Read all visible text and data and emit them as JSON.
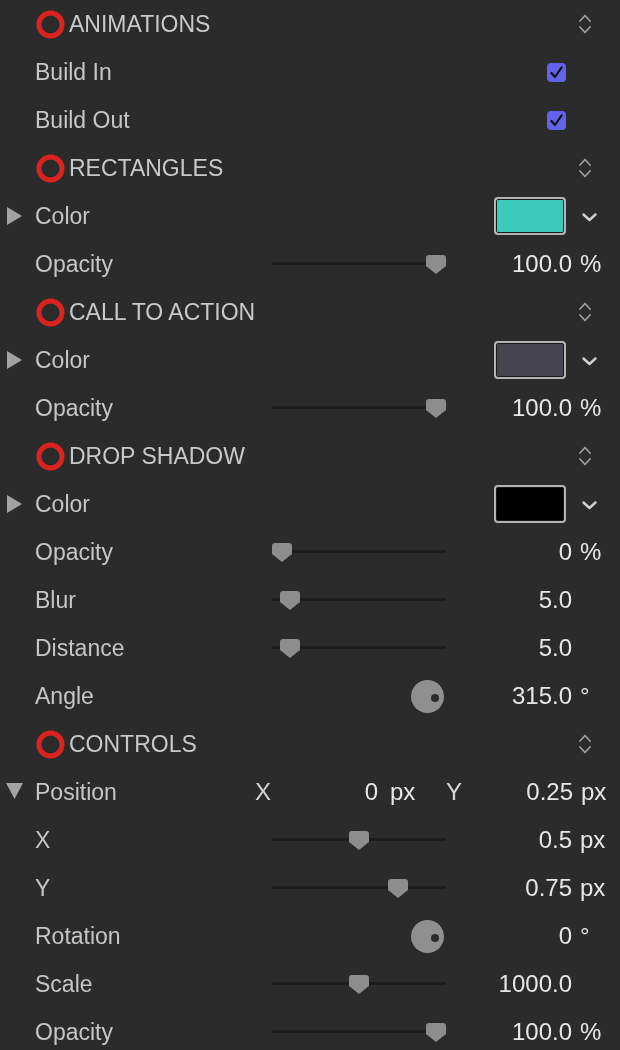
{
  "sections": [
    {
      "title": "ANIMATIONS",
      "params": [
        {
          "kind": "checkbox",
          "label": "Build In",
          "checked": true
        },
        {
          "kind": "checkbox",
          "label": "Build Out",
          "checked": true
        }
      ]
    },
    {
      "title": "RECTANGLES",
      "params": [
        {
          "kind": "color",
          "label": "Color",
          "expanded": false,
          "color": "#3ccbbb"
        },
        {
          "kind": "slider",
          "label": "Opacity",
          "level": 1,
          "value": "100.0",
          "unit": "%"
        }
      ]
    },
    {
      "title": "CALL TO ACTION",
      "params": [
        {
          "kind": "color",
          "label": "Color",
          "expanded": false,
          "color": "#46444f"
        },
        {
          "kind": "slider",
          "label": "Opacity",
          "level": 1,
          "value": "100.0",
          "unit": "%"
        }
      ]
    },
    {
      "title": "DROP SHADOW",
      "params": [
        {
          "kind": "color",
          "label": "Color",
          "expanded": false,
          "color": "#000000"
        },
        {
          "kind": "slider",
          "label": "Opacity",
          "level": 0,
          "value": "0",
          "unit": "%"
        },
        {
          "kind": "slider",
          "label": "Blur",
          "level": 0.05,
          "value": "5.0"
        },
        {
          "kind": "slider",
          "label": "Distance",
          "level": 0.05,
          "value": "5.0"
        },
        {
          "kind": "dial",
          "label": "Angle",
          "value": "315.0",
          "unit": "°"
        }
      ]
    },
    {
      "title": "CONTROLS",
      "params": [
        {
          "kind": "point",
          "label": "Position",
          "expanded": true,
          "x_label": "X",
          "x_value": "0",
          "x_unit": "px",
          "y_label": "Y",
          "y_value": "0.25",
          "y_unit": "px",
          "children": [
            {
              "kind": "slider",
              "label": "X",
              "level": 0.5,
              "value": "0.5",
              "unit": "px"
            },
            {
              "kind": "slider",
              "label": "Y",
              "level": 0.75,
              "value": "0.75",
              "unit": "px"
            }
          ]
        },
        {
          "kind": "dial",
          "label": "Rotation",
          "value": "0",
          "unit": "°"
        },
        {
          "kind": "slider",
          "label": "Scale",
          "level": 0.5,
          "value": "1000.0"
        },
        {
          "kind": "slider",
          "label": "Opacity",
          "level": 1,
          "value": "100.0",
          "unit": "%"
        }
      ]
    }
  ]
}
